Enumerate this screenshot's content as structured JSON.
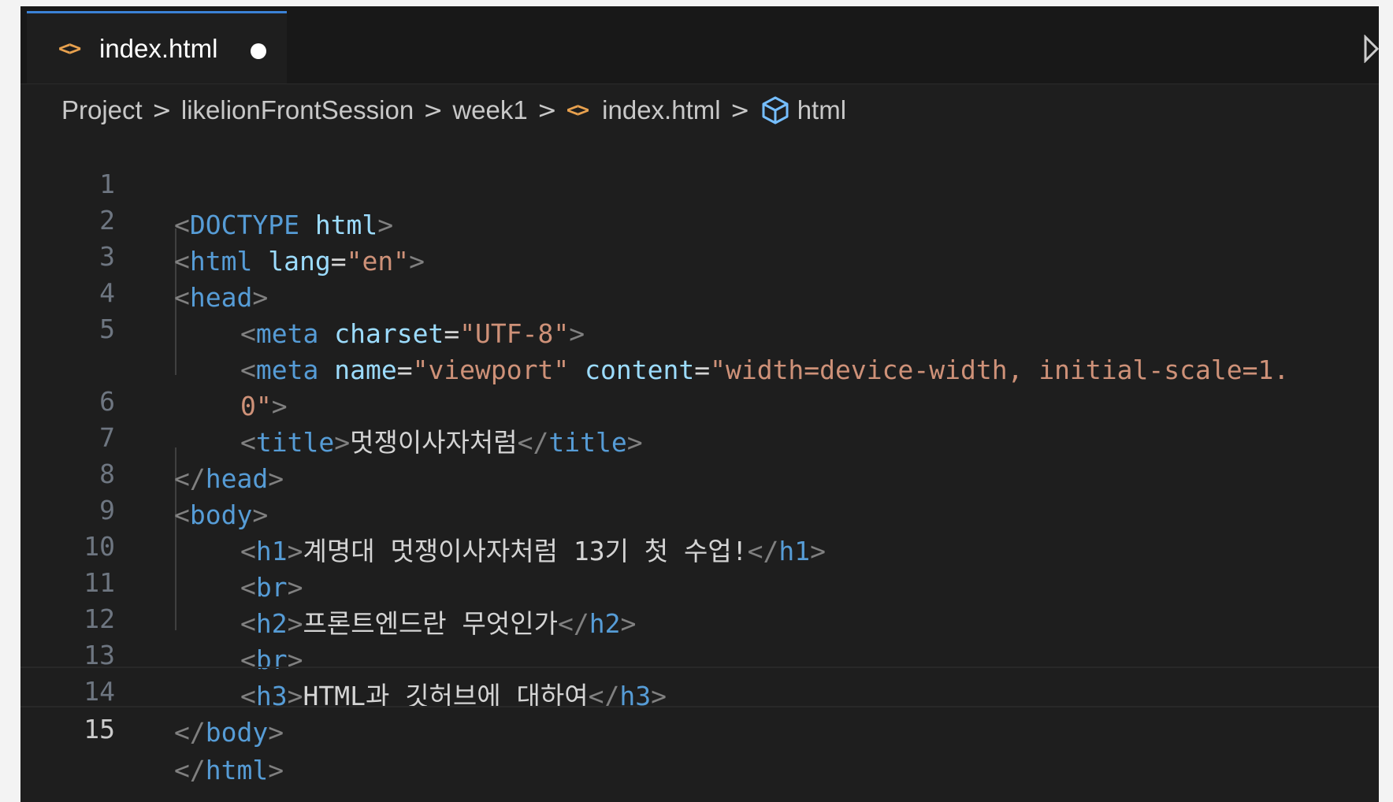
{
  "tab": {
    "icon": "<>",
    "label": "index.html"
  },
  "breadcrumb": {
    "items": [
      "Project",
      "likelionFrontSession",
      "week1",
      "index.html",
      "html"
    ],
    "separator": ">"
  },
  "editor": {
    "current_line": "15",
    "lines": [
      {
        "n": "1"
      },
      {
        "n": "2"
      },
      {
        "n": "3"
      },
      {
        "n": "4"
      },
      {
        "n": "5"
      },
      {
        "n": ""
      },
      {
        "n": "6"
      },
      {
        "n": "7"
      },
      {
        "n": "8"
      },
      {
        "n": "9"
      },
      {
        "n": "10"
      },
      {
        "n": "11"
      },
      {
        "n": "12"
      },
      {
        "n": "13"
      },
      {
        "n": "14"
      },
      {
        "n": "15"
      }
    ],
    "tokens": {
      "doctype_open": "<!",
      "doctype_kw": "DOCTYPE",
      "doctype_html": " html",
      "lt": "<",
      "lt_slash": "</",
      "gt": ">",
      "eq": "=",
      "html": "html",
      "head": "head",
      "meta": "meta",
      "title": "title",
      "body": "body",
      "h1": "h1",
      "h2": "h2",
      "h3": "h3",
      "br": "br",
      "lang": " lang",
      "en": "\"en\"",
      "charset": " charset",
      "utf8": "\"UTF-8\"",
      "name": " name",
      "viewport": "\"viewport\"",
      "content": " content",
      "content_val_1": "\"width=device-width, initial-scale=1.",
      "content_val_2": "0\"",
      "title_text": "멋쟁이사자처럼",
      "h1_text": "계명대 멋쟁이사자처럼 13기 첫 수업!",
      "h2_text": "프론트엔드란 무엇인가",
      "h3_text": "HTML과 깃허브에 대하여"
    }
  },
  "colors": {
    "editor_bg": "#1e1e1e",
    "tab_bg": "#181818",
    "tag": "#569cd6",
    "attribute": "#9cdcfe",
    "string": "#ce9178",
    "bracket": "#808080",
    "text": "#d4d4d4",
    "line_number": "#6e7681",
    "file_icon": "#e8a14e"
  },
  "icons": {
    "tab_file": "html-file-icon",
    "breadcrumb_file": "html-file-icon",
    "breadcrumb_symbol": "cube-icon",
    "run": "run-icon"
  }
}
